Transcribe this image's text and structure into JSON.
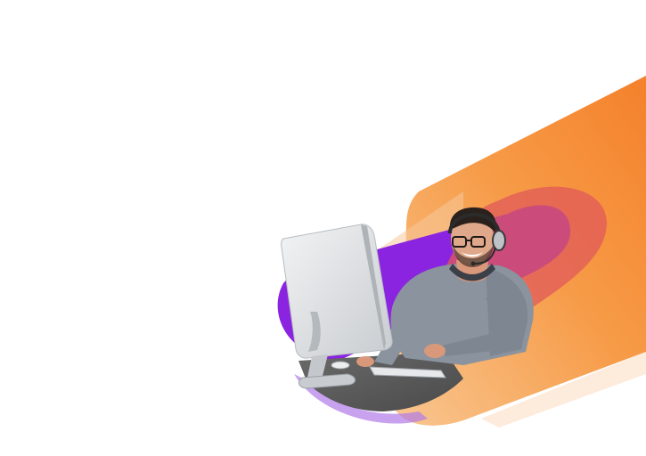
{
  "scene": {
    "subject": "person-with-headset-at-computer",
    "colors": {
      "background": "#ffffff",
      "orange_main": "#f47a20",
      "orange_light": "#f6a960",
      "purple": "#8a24e0",
      "purple_light": "#b07ae8",
      "coral": "#e05a5a",
      "sweater": "#8a939e",
      "skin": "#e0a88a",
      "hair": "#2a211c",
      "monitor": "#d9dcdf",
      "desk": "#585858"
    }
  }
}
